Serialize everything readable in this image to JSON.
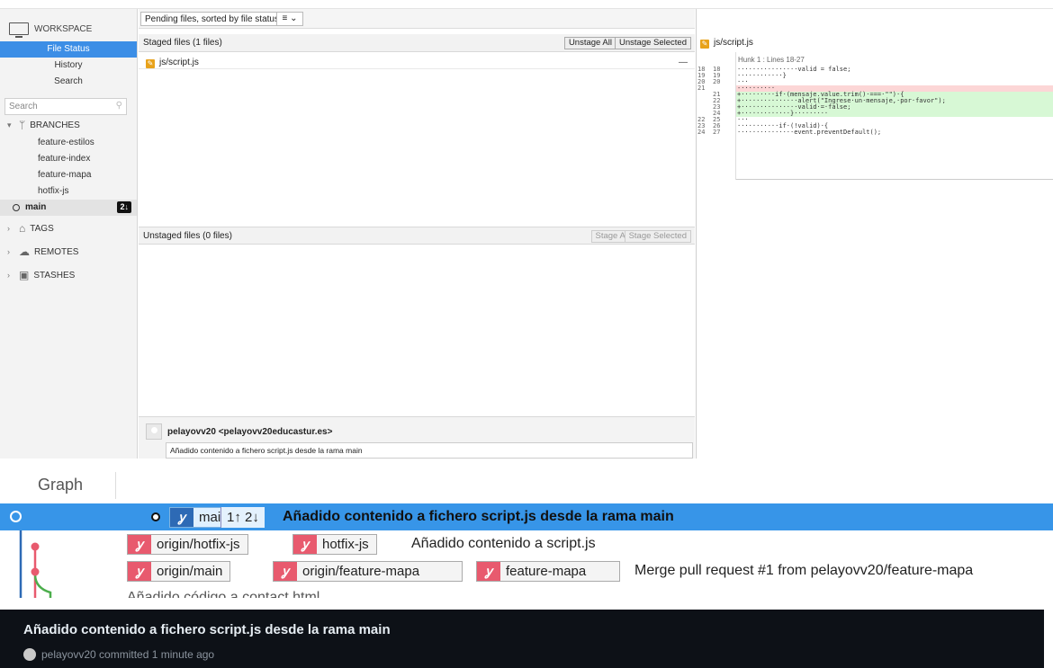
{
  "sidebar": {
    "workspace_label": "WORKSPACE",
    "nav": [
      "File Status",
      "History",
      "Search"
    ],
    "search_placeholder": "Search",
    "branches_label": "BRANCHES",
    "branches": [
      "feature-estilos",
      "feature-index",
      "feature-mapa",
      "hotfix-js"
    ],
    "current_branch": "main",
    "current_branch_count": "2↓",
    "tags_label": "TAGS",
    "remotes_label": "REMOTES",
    "stashes_label": "STASHES"
  },
  "toolbar": {
    "filter_label": "Pending files, sorted by file status",
    "list_icon": "≡"
  },
  "staged": {
    "header": "Staged files  (1 files)",
    "unstage_all": "Unstage All",
    "unstage_selected": "Unstage Selected",
    "files": [
      "js/script.js"
    ]
  },
  "unstaged": {
    "header": "Unstaged files  (0 files)",
    "stage_all": "Stage All",
    "stage_selected": "Stage Selected"
  },
  "commit": {
    "author": "pelayovv20 <pelayovv20educastur.es>",
    "message": "Añadido contenido a fichero script.js desde la rama main"
  },
  "diff": {
    "file": "js/script.js",
    "hunk": "Hunk 1 : Lines 18-27",
    "lines": [
      {
        "old": "18",
        "new": "18",
        "type": "ctx",
        "code": "················valid = false;"
      },
      {
        "old": "19",
        "new": "19",
        "type": "ctx",
        "code": "············}"
      },
      {
        "old": "20",
        "new": "20",
        "type": "ctx",
        "code": "···"
      },
      {
        "old": "21",
        "new": "",
        "type": "del",
        "code": "-·········"
      },
      {
        "old": "",
        "new": "21",
        "type": "add",
        "code": "+·········if·(mensaje.value.trim()·===·\"\")·{"
      },
      {
        "old": "",
        "new": "22",
        "type": "add",
        "code": "+···············alert(\"Ingrese·un·mensaje,·por·favor\");"
      },
      {
        "old": "",
        "new": "23",
        "type": "add",
        "code": "+···············valid·=·false;"
      },
      {
        "old": "",
        "new": "24",
        "type": "add",
        "code": "+·············}·········"
      },
      {
        "old": "22",
        "new": "25",
        "type": "ctx",
        "code": "···"
      },
      {
        "old": "23",
        "new": "26",
        "type": "ctx",
        "code": "···········if·(!valid)·{"
      },
      {
        "old": "24",
        "new": "27",
        "type": "ctx",
        "code": "···············event.preventDefault();"
      }
    ]
  },
  "graph": {
    "title": "Graph",
    "rows": [
      {
        "refs": [
          {
            "label": "main",
            "style": "local-current"
          }
        ],
        "ahead_behind": "1↑ 2↓",
        "message": "Añadido contenido a fichero script.js desde la rama main"
      },
      {
        "refs": [
          {
            "label": "origin/hotfix-js"
          },
          {
            "label": "hotfix-js"
          }
        ],
        "message": "Añadido contenido a script.js"
      },
      {
        "refs": [
          {
            "label": "origin/main"
          },
          {
            "label": "origin/feature-mapa"
          },
          {
            "label": "feature-mapa"
          }
        ],
        "message": "Merge pull request #1 from pelayovv20/feature-mapa"
      },
      {
        "refs": [],
        "message": "Añadido código a contact.html"
      }
    ]
  },
  "footer": {
    "title": "Añadido contenido a fichero script.js desde la rama main",
    "meta": "pelayovv20 committed 1 minute ago"
  }
}
